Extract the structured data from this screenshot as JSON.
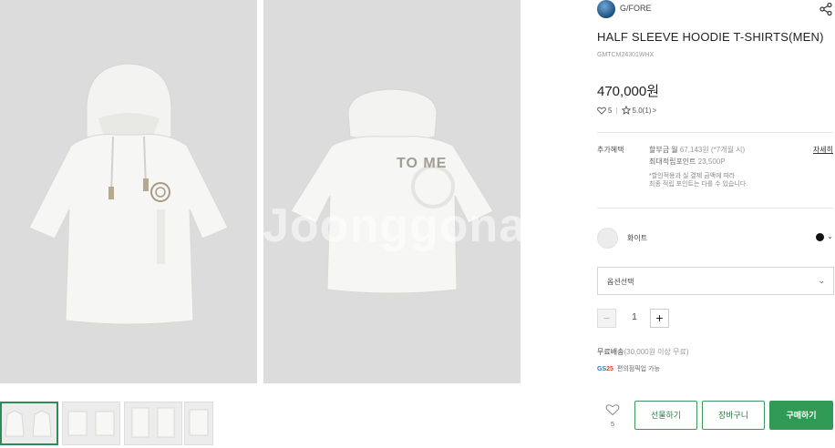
{
  "brand": {
    "name": "G/FORE"
  },
  "product": {
    "title": "HALF SLEEVE HOODIE T-SHIRTS(MEN)",
    "sku": "GMTCM24301WHX",
    "price": "470,000원",
    "wish_count": "5",
    "rating": "5.0(1)",
    "print_text": "TO ME"
  },
  "benefits": {
    "label": "추가혜택",
    "installment_prefix": "할부금 월",
    "installment_amount": "67,143원",
    "installment_suffix": "(*7개월 시)",
    "points_prefix": "최대적립포인트",
    "points_value": "23,500P",
    "note_line1": "*할인적용과 실 결제 금액에 따라",
    "note_line2": "최종 적립 포인트는 다를 수 있습니다.",
    "detail_link": "자세히"
  },
  "color": {
    "label": "화이트",
    "selected_color": "#111111"
  },
  "option": {
    "placeholder": "옵션선택"
  },
  "quantity": {
    "value": "1",
    "minus": "−",
    "plus": "+"
  },
  "shipping": {
    "prefix": "무료배송",
    "condition": "(30,000원 이상 무료)"
  },
  "gs_pickup": {
    "logo_main": "GS",
    "logo_num": "25",
    "text": "편의점픽업 가능"
  },
  "actions": {
    "gift": "선물하기",
    "cart": "장바구니",
    "buy": "구매하기",
    "wish_count": "5"
  },
  "watermark": "Joonggonara",
  "colors": {
    "accent": "#2f9a54",
    "price": "#222222",
    "panel_bg": "#dcdcdc"
  }
}
